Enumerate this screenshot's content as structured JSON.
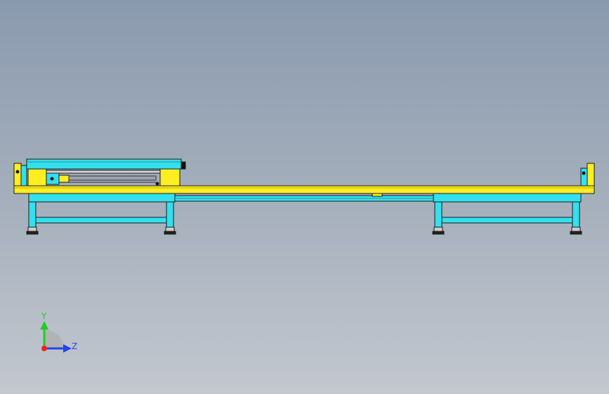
{
  "viewport": {
    "background_top": "#8a9aae",
    "background_bottom": "#c3c8cf"
  },
  "model": {
    "colors": {
      "frame_cyan": "#33e0ee",
      "rail_yellow": "#ffee22",
      "outline": "#1a1a1a",
      "shadow": "#0c0c0c"
    }
  },
  "triad": {
    "y_label": "Y",
    "z_label": "Z",
    "y_color": "#22cc22",
    "z_color": "#2244ee",
    "x_color": "#ee2222",
    "plane_color": "#b0b0b0"
  }
}
